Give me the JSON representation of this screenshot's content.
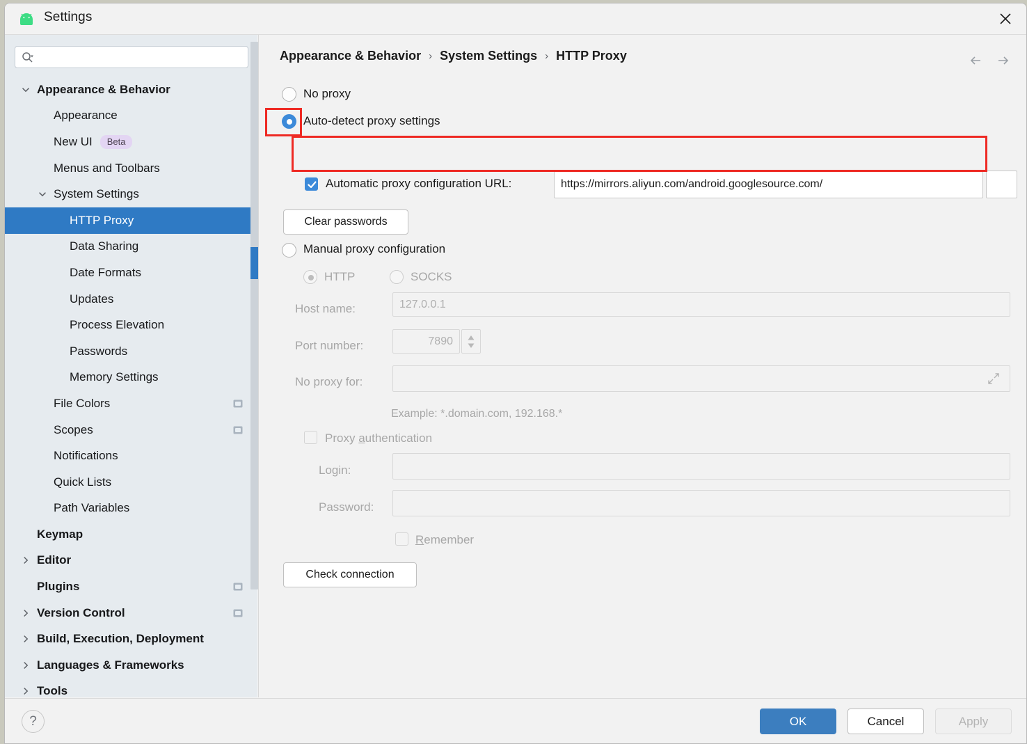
{
  "window": {
    "title": "Settings",
    "app_icon": "android-icon",
    "close_icon": "close-icon",
    "accent": "#3c8ad9",
    "selection_blue": "#2f7ac4",
    "annotation_red": "#ee2a24"
  },
  "search": {
    "placeholder": "",
    "value": "",
    "icon": "search-icon"
  },
  "sidebar": {
    "items": [
      {
        "label": "Appearance & Behavior",
        "indent": 46,
        "bold": true,
        "chevron": "down",
        "selected": false,
        "badge": null,
        "trailing": null
      },
      {
        "label": "Appearance",
        "indent": 70,
        "bold": false,
        "chevron": null,
        "selected": false,
        "badge": null,
        "trailing": null
      },
      {
        "label": "New UI",
        "indent": 70,
        "bold": false,
        "chevron": null,
        "selected": false,
        "badge": "Beta",
        "trailing": null
      },
      {
        "label": "Menus and Toolbars",
        "indent": 70,
        "bold": false,
        "chevron": null,
        "selected": false,
        "badge": null,
        "trailing": null
      },
      {
        "label": "System Settings",
        "indent": 70,
        "bold": false,
        "chevron": "down",
        "selected": false,
        "badge": null,
        "trailing": null
      },
      {
        "label": "HTTP Proxy",
        "indent": 93,
        "bold": false,
        "chevron": null,
        "selected": true,
        "badge": null,
        "trailing": null
      },
      {
        "label": "Data Sharing",
        "indent": 93,
        "bold": false,
        "chevron": null,
        "selected": false,
        "badge": null,
        "trailing": null
      },
      {
        "label": "Date Formats",
        "indent": 93,
        "bold": false,
        "chevron": null,
        "selected": false,
        "badge": null,
        "trailing": null
      },
      {
        "label": "Updates",
        "indent": 93,
        "bold": false,
        "chevron": null,
        "selected": false,
        "badge": null,
        "trailing": null
      },
      {
        "label": "Process Elevation",
        "indent": 93,
        "bold": false,
        "chevron": null,
        "selected": false,
        "badge": null,
        "trailing": null
      },
      {
        "label": "Passwords",
        "indent": 93,
        "bold": false,
        "chevron": null,
        "selected": false,
        "badge": null,
        "trailing": null
      },
      {
        "label": "Memory Settings",
        "indent": 93,
        "bold": false,
        "chevron": null,
        "selected": false,
        "badge": null,
        "trailing": null
      },
      {
        "label": "File Colors",
        "indent": 70,
        "bold": false,
        "chevron": null,
        "selected": false,
        "badge": null,
        "trailing": "scope-icon"
      },
      {
        "label": "Scopes",
        "indent": 70,
        "bold": false,
        "chevron": null,
        "selected": false,
        "badge": null,
        "trailing": "scope-icon"
      },
      {
        "label": "Notifications",
        "indent": 70,
        "bold": false,
        "chevron": null,
        "selected": false,
        "badge": null,
        "trailing": null
      },
      {
        "label": "Quick Lists",
        "indent": 70,
        "bold": false,
        "chevron": null,
        "selected": false,
        "badge": null,
        "trailing": null
      },
      {
        "label": "Path Variables",
        "indent": 70,
        "bold": false,
        "chevron": null,
        "selected": false,
        "badge": null,
        "trailing": null
      },
      {
        "label": "Keymap",
        "indent": 46,
        "bold": true,
        "chevron": null,
        "selected": false,
        "badge": null,
        "trailing": null
      },
      {
        "label": "Editor",
        "indent": 46,
        "bold": true,
        "chevron": "right",
        "selected": false,
        "badge": null,
        "trailing": null
      },
      {
        "label": "Plugins",
        "indent": 46,
        "bold": true,
        "chevron": null,
        "selected": false,
        "badge": null,
        "trailing": "scope-icon"
      },
      {
        "label": "Version Control",
        "indent": 46,
        "bold": true,
        "chevron": "right",
        "selected": false,
        "badge": null,
        "trailing": "scope-icon"
      },
      {
        "label": "Build, Execution, Deployment",
        "indent": 46,
        "bold": true,
        "chevron": "right",
        "selected": false,
        "badge": null,
        "trailing": null
      },
      {
        "label": "Languages & Frameworks",
        "indent": 46,
        "bold": true,
        "chevron": "right",
        "selected": false,
        "badge": null,
        "trailing": null
      },
      {
        "label": "Tools",
        "indent": 46,
        "bold": true,
        "chevron": "right",
        "selected": false,
        "badge": null,
        "trailing": null
      }
    ]
  },
  "breadcrumb": {
    "items": [
      "Appearance & Behavior",
      "System Settings",
      "HTTP Proxy"
    ],
    "separator": "›",
    "back_icon": "arrow-left-icon",
    "forward_icon": "arrow-right-icon"
  },
  "proxy": {
    "no_proxy": {
      "label": "No proxy",
      "checked": false
    },
    "auto_detect": {
      "label": "Auto-detect proxy settings",
      "checked": true,
      "highlighted": true
    },
    "pac": {
      "label": "Automatic proxy configuration URL:",
      "checked": true,
      "url": "https://mirrors.aliyun.com/android.googlesource.com/",
      "highlighted": true
    },
    "clear_passwords_label": "Clear passwords",
    "manual": {
      "label": "Manual proxy configuration",
      "checked": false,
      "protocol_http": {
        "label": "HTTP",
        "selected": true
      },
      "protocol_socks": {
        "label": "SOCKS",
        "selected": false
      },
      "host_name_label": "Host name:",
      "host_name_value": "127.0.0.1",
      "port_label": "Port number:",
      "port_value": "7890",
      "no_proxy_for_label": "No proxy for:",
      "no_proxy_for_value": "",
      "example_hint": "Example: *.domain.com, 192.168.*",
      "auth": {
        "label_pre": "Proxy ",
        "label_mnemonic": "a",
        "label_post": "uthentication",
        "checked": false,
        "login_label": "Login:",
        "login_value": "",
        "password_label": "Password:",
        "password_value": "",
        "remember_mnemonic": "R",
        "remember_post": "emember",
        "remember_checked": false
      }
    },
    "check_connection_label": "Check connection"
  },
  "footer": {
    "help_label": "?",
    "ok_label": "OK",
    "cancel_label": "Cancel",
    "apply_label": "Apply",
    "apply_enabled": false
  }
}
